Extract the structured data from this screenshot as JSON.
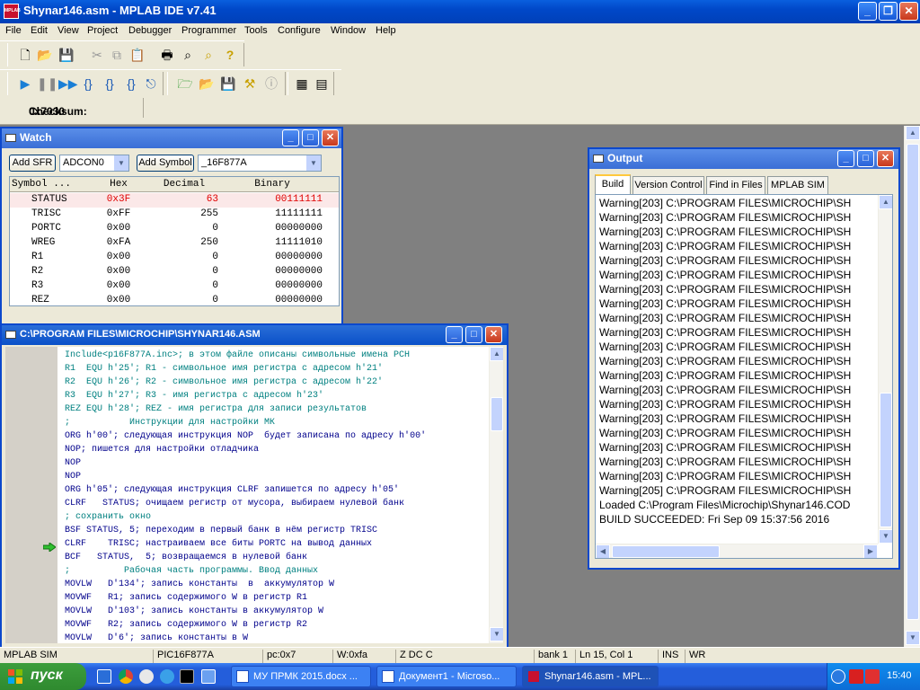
{
  "app": {
    "title": "Shynar146.asm - MPLAB IDE v7.41",
    "icon": "MPLAB"
  },
  "menu": [
    "File",
    "Edit",
    "View",
    "Project",
    "Debugger",
    "Programmer",
    "Tools",
    "Configure",
    "Window",
    "Help"
  ],
  "checksum": {
    "label": "Checksum:",
    "value": "0x7030"
  },
  "watch": {
    "title": "Watch",
    "add_sfr": "Add SFR",
    "sfr_select": "ADCON0",
    "add_symbol": "Add Symbol",
    "symbol_select": "_16F877A",
    "columns": [
      "Symbol ...",
      "Hex",
      "Decimal",
      "Binary"
    ],
    "rows": [
      {
        "symbol": "STATUS",
        "hex": "0x3F",
        "dec": "63",
        "bin": "00111111",
        "changed": true
      },
      {
        "symbol": "TRISC",
        "hex": "0xFF",
        "dec": "255",
        "bin": "11111111",
        "changed": false
      },
      {
        "symbol": "PORTC",
        "hex": "0x00",
        "dec": "0",
        "bin": "00000000",
        "changed": false
      },
      {
        "symbol": "WREG",
        "hex": "0xFA",
        "dec": "250",
        "bin": "11111010",
        "changed": false
      },
      {
        "symbol": "R1",
        "hex": "0x00",
        "dec": "0",
        "bin": "00000000",
        "changed": false
      },
      {
        "symbol": "R2",
        "hex": "0x00",
        "dec": "0",
        "bin": "00000000",
        "changed": false
      },
      {
        "symbol": "R3",
        "hex": "0x00",
        "dec": "0",
        "bin": "00000000",
        "changed": false
      },
      {
        "symbol": "REZ",
        "hex": "0x00",
        "dec": "0",
        "bin": "00000000",
        "changed": false
      }
    ]
  },
  "editor": {
    "title": "C:\\PROGRAM FILES\\MICROCHIP\\SHYNAR146.ASM",
    "lines": [
      "Include<p16F877A.inc>; в этом файле описаны символьные имена РСН",
      "R1  EQU h'25'; R1 - символьное имя регистра с адресом h'21'",
      "R2  EQU h'26'; R2 - символьное имя регистра с адресом h'22'",
      "R3  EQU h'27'; R3 - имя регистра с адресом h'23'",
      "REZ EQU h'28'; REZ - имя регистра для записи результатов",
      ";           Инструкции для настройки МК",
      "ORG h'00'; следующая инструкция NOP  будет записана по адресу h'00'",
      "NOP; пишется для настройки отладчика",
      "NOP",
      "NOP",
      "ORG h'05'; следующая инструкция CLRF запишется по адресу h'05'",
      "CLRF   STATUS; очищаем регистр от мусора, выбираем нулевой банк",
      "; сохранить окно",
      "BSF STATUS, 5; переходим в первый банк в нём регистр TRISC",
      "CLRF    TRISC; настраиваем все биты PORTC на вывод данных",
      "BCF   STATUS,  5; возвращаемся в нулевой банк",
      ";          Рабочая часть программы. Ввод данных",
      "MOVLW   D'134'; запись константы  в  аккумулятор W",
      "MOVWF   R1; запись содержимого W в регистр R1",
      "MOVLW   D'103'; запись константы в аккумулятор W",
      "MOVWF   R2; запись содержимого W в регистр R2",
      "MOVLW   D'6'; запись константы в W"
    ]
  },
  "output": {
    "title": "Output",
    "tabs": [
      "Build",
      "Version Control",
      "Find in Files",
      "MPLAB SIM"
    ],
    "lines": [
      "Warning[203] C:\\PROGRAM FILES\\MICROCHIP\\SH",
      "Warning[203] C:\\PROGRAM FILES\\MICROCHIP\\SH",
      "Warning[203] C:\\PROGRAM FILES\\MICROCHIP\\SH",
      "Warning[203] C:\\PROGRAM FILES\\MICROCHIP\\SH",
      "Warning[203] C:\\PROGRAM FILES\\MICROCHIP\\SH",
      "Warning[203] C:\\PROGRAM FILES\\MICROCHIP\\SH",
      "Warning[203] C:\\PROGRAM FILES\\MICROCHIP\\SH",
      "Warning[203] C:\\PROGRAM FILES\\MICROCHIP\\SH",
      "Warning[203] C:\\PROGRAM FILES\\MICROCHIP\\SH",
      "Warning[203] C:\\PROGRAM FILES\\MICROCHIP\\SH",
      "Warning[203] C:\\PROGRAM FILES\\MICROCHIP\\SH",
      "Warning[203] C:\\PROGRAM FILES\\MICROCHIP\\SH",
      "Warning[203] C:\\PROGRAM FILES\\MICROCHIP\\SH",
      "Warning[203] C:\\PROGRAM FILES\\MICROCHIP\\SH",
      "Warning[203] C:\\PROGRAM FILES\\MICROCHIP\\SH",
      "Warning[203] C:\\PROGRAM FILES\\MICROCHIP\\SH",
      "Warning[203] C:\\PROGRAM FILES\\MICROCHIP\\SH",
      "Warning[203] C:\\PROGRAM FILES\\MICROCHIP\\SH",
      "Warning[203] C:\\PROGRAM FILES\\MICROCHIP\\SH",
      "Warning[203] C:\\PROGRAM FILES\\MICROCHIP\\SH",
      "Warning[205] C:\\PROGRAM FILES\\MICROCHIP\\SH",
      "Loaded C:\\Program Files\\Microchip\\Shynar146.COD",
      "BUILD SUCCEEDED: Fri Sep 09 15:37:56 2016"
    ]
  },
  "status": [
    "MPLAB SIM",
    "PIC16F877A",
    "pc:0x7",
    "W:0xfa",
    "Z DC C",
    "bank 1",
    "Ln 15, Col 1",
    "INS",
    "WR"
  ],
  "taskbar": {
    "start": "пуск",
    "tasks": [
      "МУ ПРМК 2015.docx ...",
      "Документ1 - Microso...",
      "Shynar146.asm - MPL..."
    ],
    "clock": "15:40"
  }
}
